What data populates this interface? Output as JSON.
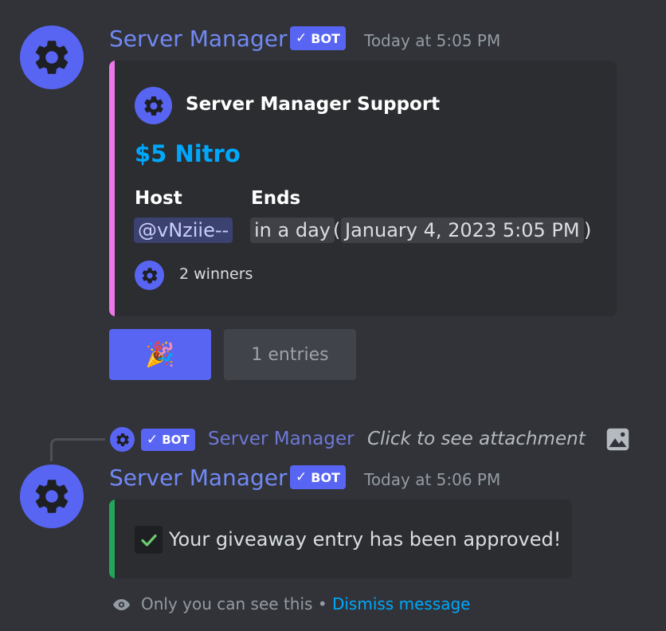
{
  "message1": {
    "author": "Server Manager",
    "bot_badge": "BOT",
    "timestamp": "Today at 5:05 PM",
    "embed": {
      "accent_color": "#eb78e9",
      "author_name": "Server Manager Support",
      "title": "$5 Nitro",
      "fields": {
        "host_label": "Host",
        "host_value": "@vNziie--",
        "ends_label": "Ends",
        "ends_relative": "in a day",
        "ends_open_paren": "(",
        "ends_absolute": "January 4, 2023 5:05 PM",
        "ends_close_paren": ")"
      },
      "footer": "2 winners"
    },
    "buttons": {
      "enter_emoji": "🎉",
      "entries_label": "1 entries"
    }
  },
  "reply_preview": {
    "bot_badge": "BOT",
    "author": "Server Manager",
    "text": "Click to see attachment",
    "icon": "image-icon"
  },
  "message2": {
    "author": "Server Manager",
    "bot_badge": "BOT",
    "timestamp": "Today at 5:06 PM",
    "embed": {
      "accent_color": "#23a55a",
      "check_icon": "check-mark",
      "text": "Your giveaway entry has been approved!"
    },
    "ephemeral": {
      "note": "Only you can see this",
      "separator": "•",
      "dismiss": "Dismiss message"
    }
  },
  "colors": {
    "background": "#313338",
    "embed_bg": "#2b2d31",
    "blurple": "#5865f2",
    "username": "#7289f5",
    "link": "#00a8fc"
  }
}
